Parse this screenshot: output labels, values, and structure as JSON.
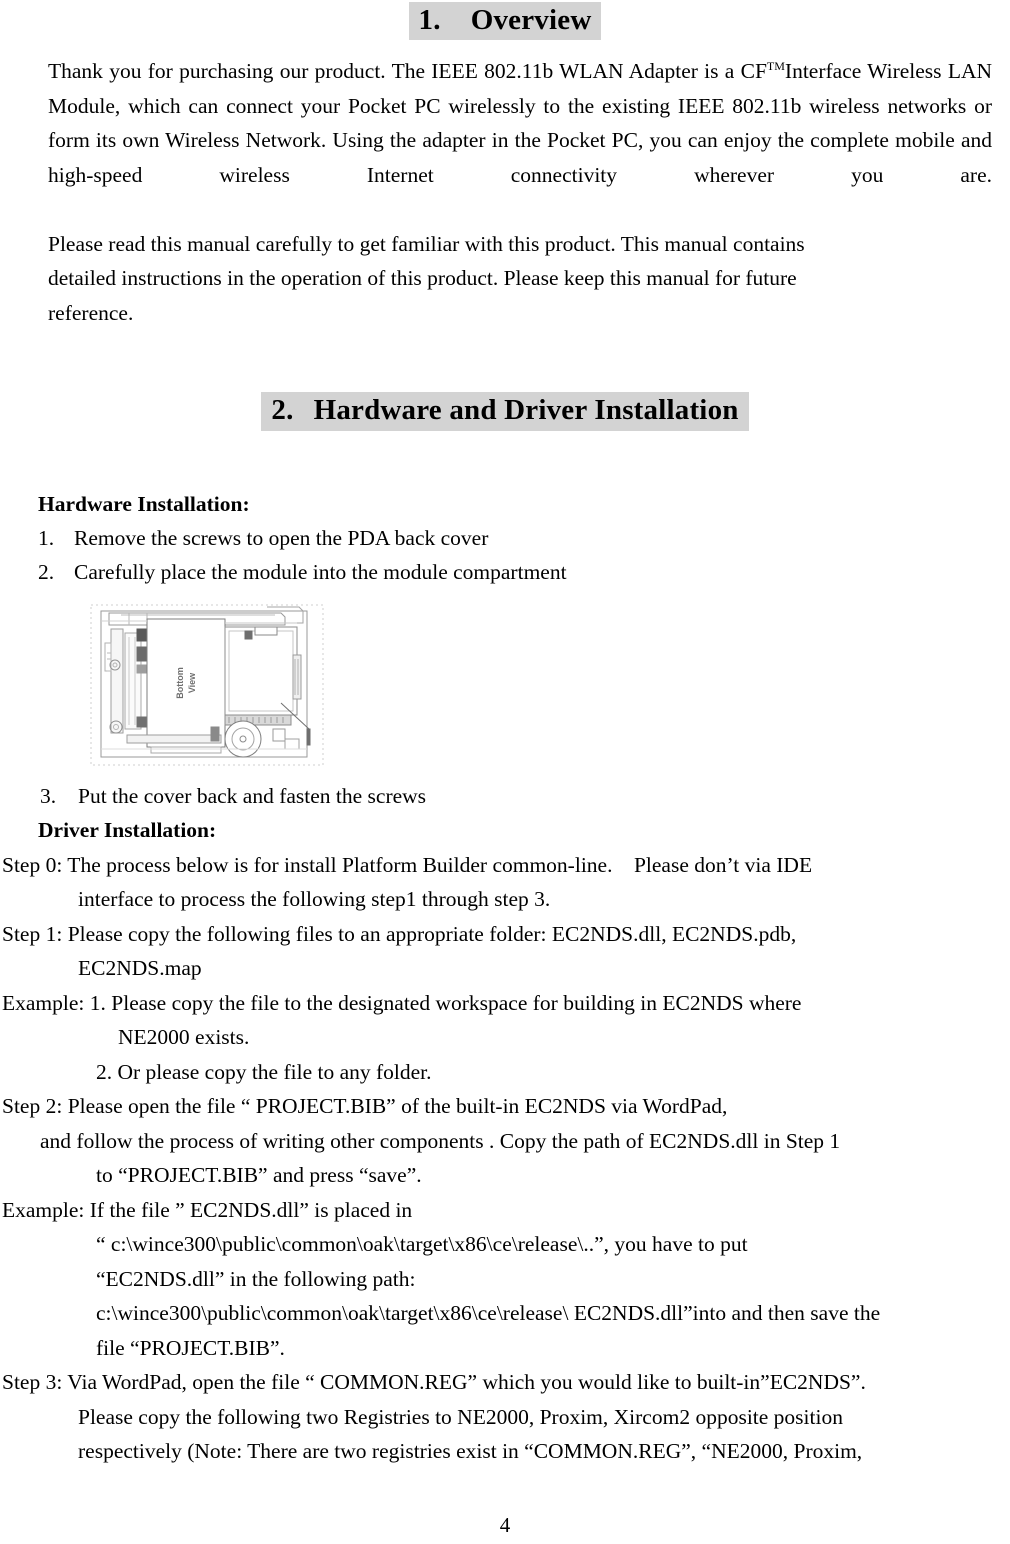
{
  "document": {
    "page_number": "4",
    "highlight_color": "#d3d3d3",
    "text_color": "#000000",
    "background_color": "#ffffff"
  },
  "section1": {
    "number": "1.",
    "title": "Overview",
    "paragraph1_part1": "Thank you for purchasing our product.  The IEEE 802.11b WLAN Adapter is a CF",
    "paragraph1_tm": "TM",
    "paragraph1_part2": "Interface Wireless LAN Module, which can connect your Pocket PC wirelessly to the existing IEEE 802.11b wireless networks or form its own Wireless Network.  Using the adapter in the Pocket PC, you can enjoy the complete mobile and high-speed wireless Internet connectivity wherever you are.",
    "paragraph2_line1": "Please read this manual carefully to get familiar with this product. This manual contains",
    "paragraph2_line2": "detailed instructions in the operation of this product.    Please keep this manual for future",
    "paragraph2_line3": "reference."
  },
  "section2": {
    "number": "2.",
    "title": "Hardware and Driver Installation",
    "hardware_heading": "Hardware Installation:",
    "hardware_steps": [
      {
        "mark": "1.",
        "text": "Remove the screws to open the PDA back cover"
      },
      {
        "mark": "2.",
        "text": "Carefully place the module into the module compartment"
      },
      {
        "mark": "3.",
        "text": "Put the cover back and fasten the screws"
      }
    ],
    "figure": {
      "caption": "Bottom View",
      "alt": "Technical line drawing of PDA back cover with module compartment, bottom view"
    },
    "driver_heading": "Driver Installation:",
    "driver_lines": [
      {
        "indent": "ind-0",
        "text": "Step 0: The process below is for install Platform Builder common-line.    Please don’t via IDE"
      },
      {
        "indent": "ind-2",
        "text": "interface to process the following step1 through step 3."
      },
      {
        "indent": "ind-0",
        "text": "Step 1: Please copy the following files to an appropriate folder: EC2NDS.dll, EC2NDS.pdb,"
      },
      {
        "indent": "ind-2",
        "text": "EC2NDS.map"
      },
      {
        "indent": "ind-0",
        "text": "Example: 1. Please copy the file to the designated workspace for building in EC2NDS where"
      },
      {
        "indent": "ind-4",
        "text": "NE2000 exists."
      },
      {
        "indent": "ind-3",
        "text": "2. Or please copy the file to any folder."
      },
      {
        "indent": "ind-0",
        "text": "Step 2: Please open the file “ PROJECT.BIB” of the built-in EC2NDS via WordPad,"
      },
      {
        "indent": "ind-1",
        "text": "and follow the process of writing other components . Copy the path of EC2NDS.dll in Step 1"
      },
      {
        "indent": "ind-3",
        "text": "to “PROJECT.BIB” and press “save”."
      },
      {
        "indent": "ind-0",
        "text": "Example: If the file ” EC2NDS.dll” is placed in"
      },
      {
        "indent": "ind-3",
        "text": "“ c:\\wince300\\public\\common\\oak\\target\\x86\\ce\\release\\..”, you have to put"
      },
      {
        "indent": "ind-3",
        "text": "“EC2NDS.dll” in the following path:"
      },
      {
        "indent": "ind-3",
        "text": "c:\\wince300\\public\\common\\oak\\target\\x86\\ce\\release\\ EC2NDS.dll”into and then save the"
      },
      {
        "indent": "ind-3",
        "text": "file “PROJECT.BIB”."
      },
      {
        "indent": "ind-0",
        "text": "Step 3: Via WordPad, open the file “ COMMON.REG” which you would like to built-in”EC2NDS”."
      },
      {
        "indent": "ind-2",
        "text": "Please copy the following two Registries to NE2000, Proxim, Xircom2 opposite position"
      },
      {
        "indent": "ind-2",
        "text": "respectively (Note: There are two registries exist in “COMMON.REG”, “NE2000, Proxim,"
      }
    ]
  }
}
